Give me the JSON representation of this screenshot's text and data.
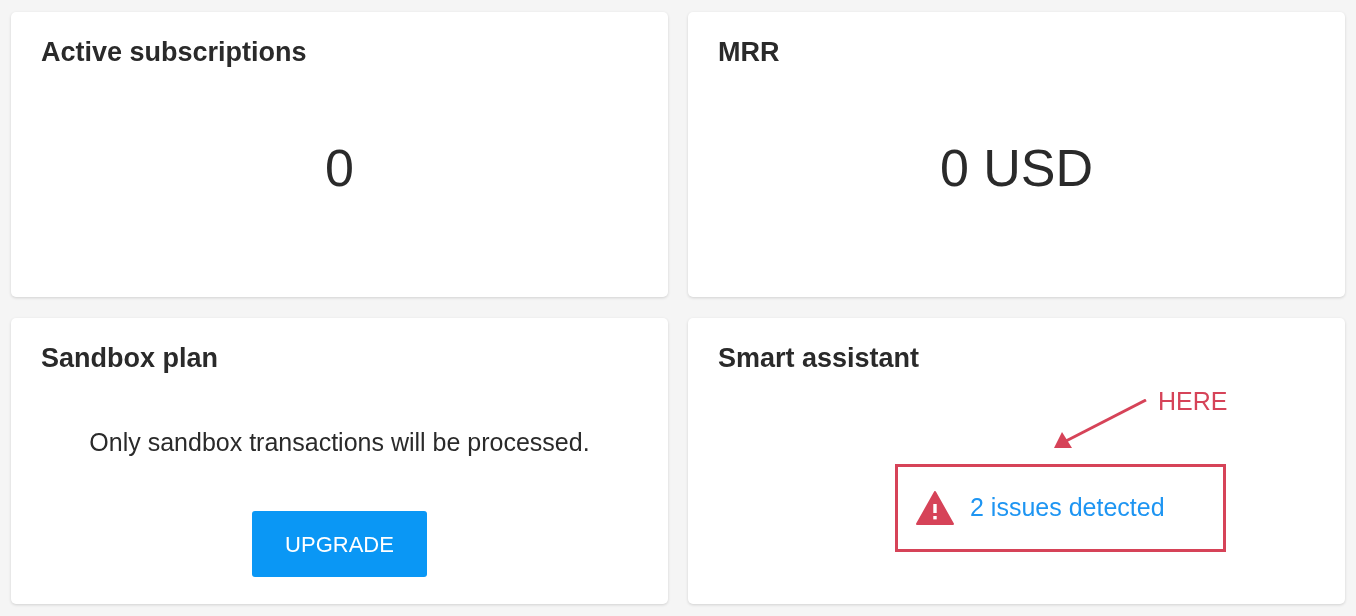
{
  "cards": [
    {
      "kind": "metric",
      "title": "Active subscriptions",
      "value": "0"
    },
    {
      "kind": "metric",
      "title": "MRR",
      "value": "0 USD"
    },
    {
      "kind": "plan",
      "title": "Sandbox plan",
      "message": "Only sandbox transactions will be processed.",
      "button": "UPGRADE"
    },
    {
      "kind": "issues",
      "title": "Smart assistant",
      "link": "2 issues detected",
      "annotation": "HERE"
    }
  ]
}
